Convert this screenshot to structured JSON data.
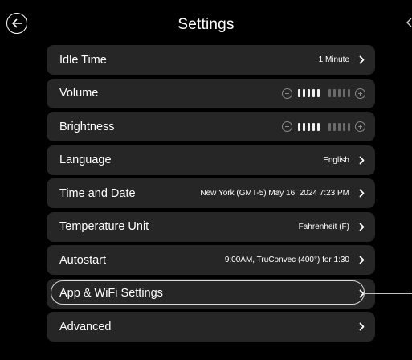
{
  "header": {
    "title": "Settings"
  },
  "colors": {
    "background": "#000000",
    "row_background": "#262626",
    "text": "#ffffff",
    "highlight_outline": "#d8d8d8"
  },
  "icons": {
    "back": "arrow-left-icon",
    "chevron": "chevron-right-icon",
    "minus": "minus-circle-icon",
    "plus": "plus-circle-icon"
  },
  "settings": {
    "idle_time": {
      "label": "Idle Time",
      "value": "1 Minute"
    },
    "volume": {
      "label": "Volume",
      "level": 5,
      "max": 10
    },
    "brightness": {
      "label": "Brightness",
      "level": 5,
      "max": 10
    },
    "language": {
      "label": "Language",
      "value": "English"
    },
    "time_date": {
      "label": "Time and Date",
      "value": "New York (GMT-5) May 16, 2024 7:23 PM"
    },
    "temperature_unit": {
      "label": "Temperature Unit",
      "value": "Fahrenheit (F)"
    },
    "autostart": {
      "label": "Autostart",
      "value": "9:00AM, TruConvec (400°) for 1:30"
    },
    "app_wifi": {
      "label": "App & WiFi Settings",
      "value": "",
      "highlighted": true
    },
    "advanced": {
      "label": "Advanced",
      "value": ""
    }
  }
}
